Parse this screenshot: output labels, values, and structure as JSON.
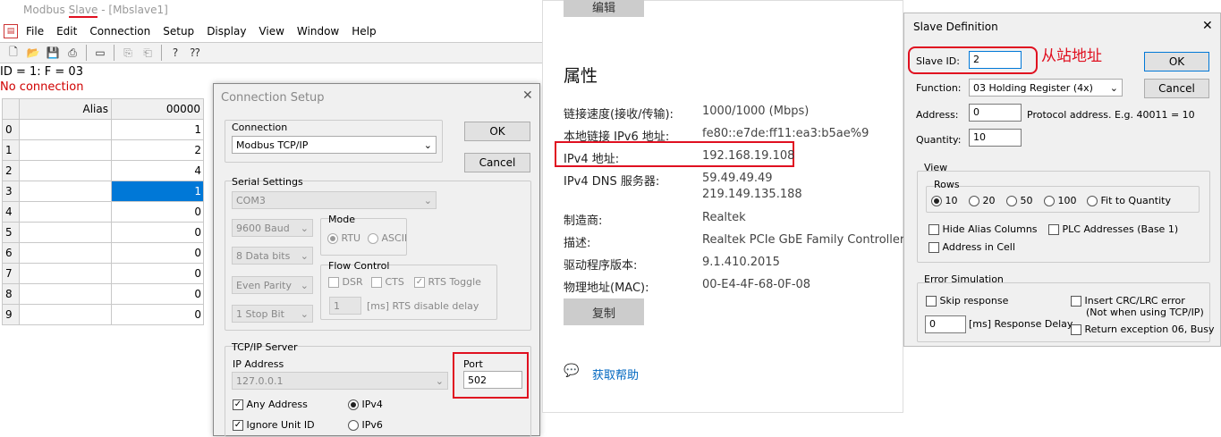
{
  "modbus": {
    "title_app": "Modbus",
    "title_slave": "Slave",
    "title_rest": " - [Mbslave1]",
    "menu": [
      "File",
      "Edit",
      "Connection",
      "Setup",
      "Display",
      "View",
      "Window",
      "Help"
    ],
    "status_id": "ID = 1: F = 03",
    "status_conn": "No connection",
    "grid": {
      "col_alias": "Alias",
      "col_addr": "00000",
      "rows": [
        {
          "n": "0",
          "v": "1"
        },
        {
          "n": "1",
          "v": "2"
        },
        {
          "n": "2",
          "v": "4"
        },
        {
          "n": "3",
          "v": "1"
        },
        {
          "n": "4",
          "v": "0"
        },
        {
          "n": "5",
          "v": "0"
        },
        {
          "n": "6",
          "v": "0"
        },
        {
          "n": "7",
          "v": "0"
        },
        {
          "n": "8",
          "v": "0"
        },
        {
          "n": "9",
          "v": "0"
        }
      ]
    }
  },
  "conn_setup": {
    "title": "Connection Setup",
    "connection_group": "Connection",
    "connection_value": "Modbus TCP/IP",
    "ok": "OK",
    "cancel": "Cancel",
    "serial_group": "Serial Settings",
    "com": "COM3",
    "baud": "9600 Baud",
    "data_bits": "8 Data bits",
    "parity": "Even Parity",
    "stop_bits": "1 Stop Bit",
    "mode_group": "Mode",
    "mode_rtu": "RTU",
    "mode_ascii": "ASCII",
    "flow_group": "Flow Control",
    "dsr": "DSR",
    "cts": "CTS",
    "rts_toggle": "RTS Toggle",
    "rts_delay_value": "1",
    "rts_delay_label": "[ms] RTS disable delay",
    "tcp_group": "TCP/IP Server",
    "ip_label": "IP Address",
    "ip_value": "127.0.0.1",
    "port_label": "Port",
    "port_value": "502",
    "any_address": "Any Address",
    "ignore_unit": "Ignore Unit ID",
    "ipv4": "IPv4",
    "ipv6": "IPv6"
  },
  "net": {
    "edit_button": "编辑",
    "heading": "属性",
    "rows": [
      {
        "label": "链接速度(接收/传输):",
        "value": "1000/1000 (Mbps)"
      },
      {
        "label": "本地链接 IPv6 地址:",
        "value": "fe80::e7de:ff11:ea3:b5ae%9"
      },
      {
        "label": "IPv4 地址:",
        "value": "192.168.19.108"
      },
      {
        "label": "IPv4 DNS 服务器:",
        "value": "59.49.49.49"
      },
      {
        "label": "",
        "value": "219.149.135.188"
      },
      {
        "label": "制造商:",
        "value": "Realtek"
      },
      {
        "label": "描述:",
        "value": "Realtek PCIe GbE Family Controller"
      },
      {
        "label": "驱动程序版本:",
        "value": "9.1.410.2015"
      },
      {
        "label": "物理地址(MAC):",
        "value": "00-E4-4F-68-0F-08"
      }
    ],
    "copy_button": "复制",
    "help_link": "获取帮助"
  },
  "slave_def": {
    "title": "Slave Definition",
    "slave_id_label": "Slave ID:",
    "slave_id_value": "2",
    "annotation": "从站地址",
    "ok": "OK",
    "cancel": "Cancel",
    "function_label": "Function:",
    "function_value": "03 Holding Register (4x)",
    "address_label": "Address:",
    "address_value": "0",
    "address_hint": "Protocol address. E.g. 40011 = 10",
    "quantity_label": "Quantity:",
    "quantity_value": "10",
    "view_group": "View",
    "rows_group": "Rows",
    "rows_options": [
      "10",
      "20",
      "50",
      "100",
      "Fit to Quantity"
    ],
    "hide_alias": "Hide Alias Columns",
    "plc_addresses": "PLC Addresses (Base 1)",
    "address_in_cell": "Address in Cell",
    "error_group": "Error Simulation",
    "skip_response": "Skip response",
    "insert_crc": "Insert CRC/LRC error",
    "insert_crc_note": "(Not when using TCP/IP)",
    "delay_value": "0",
    "delay_label": "[ms] Response Delay",
    "return_exception": "Return exception 06, Busy"
  },
  "colors": {
    "annotation_red": "#e01020",
    "selection_blue": "#0078d7",
    "link_blue": "#0067c0"
  }
}
